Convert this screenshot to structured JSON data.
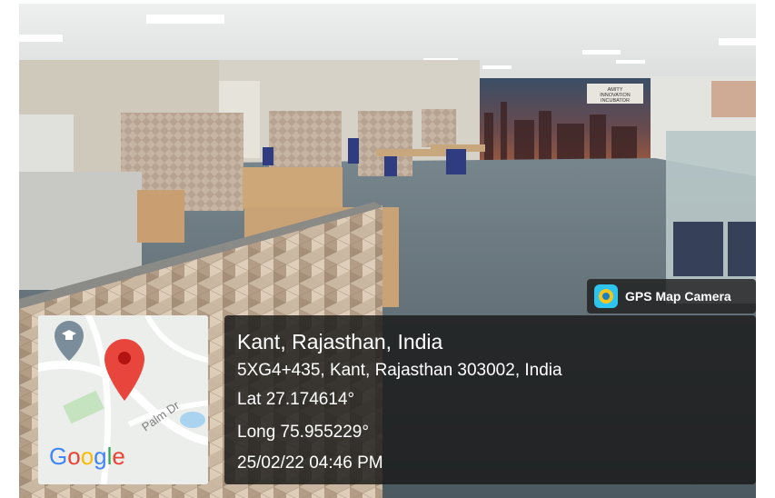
{
  "gps_badge": {
    "label": "GPS Map Camera",
    "icon": "gps-map-camera-app-icon"
  },
  "location": {
    "city": "Kant, Rajasthan, India",
    "address": "5XG4+435, Kant, Rajasthan 303002, India",
    "lat": "Lat 27.174614°",
    "long": "Long 75.955229°",
    "datetime": "25/02/22 04:46 PM"
  },
  "map": {
    "street_label": "Palm Dr",
    "logo_text": [
      "G",
      "o",
      "o",
      "g",
      "l",
      "e"
    ],
    "pin_icon": "map-pin-icon",
    "school_icon": "graduation-cap-icon"
  },
  "mural": {
    "line1": "AMITY",
    "line2": "INNOVATION",
    "line3": "INCUBATOR"
  },
  "colors": {
    "panel_bg": "#191919",
    "pin_red": "#e8453c",
    "floor": "#5f6c74"
  }
}
